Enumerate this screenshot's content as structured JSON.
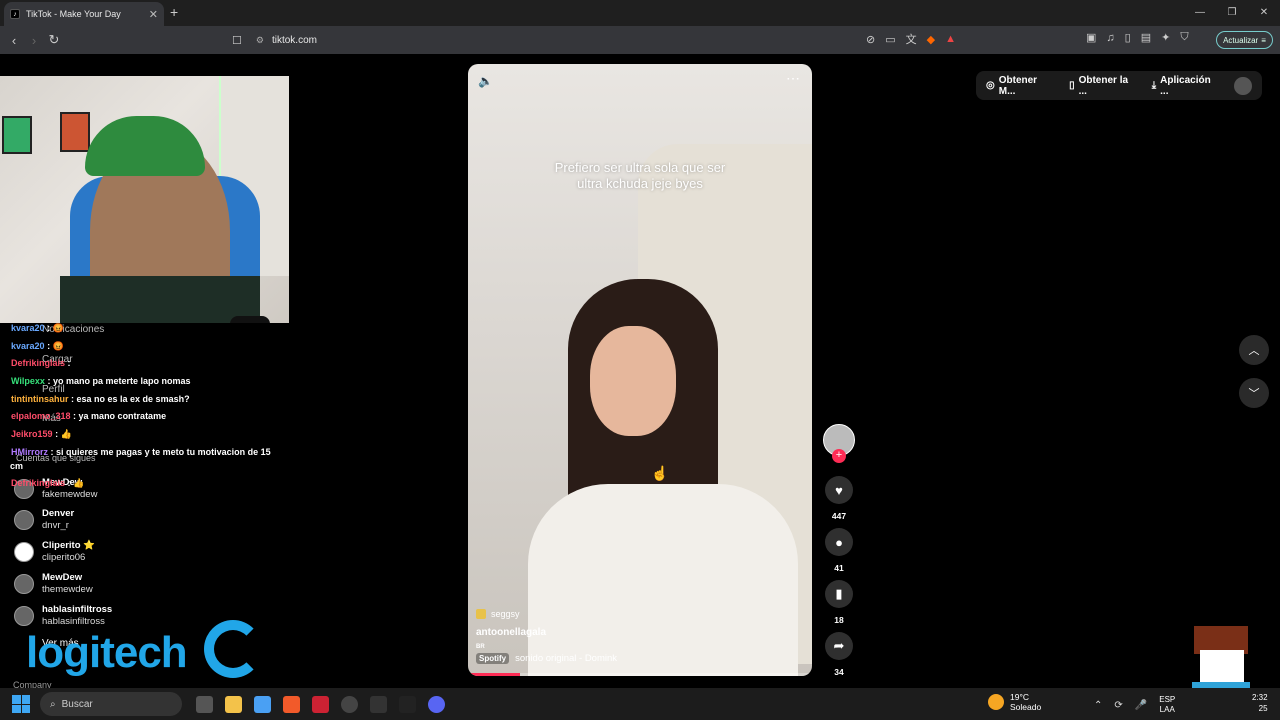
{
  "browser": {
    "tab_title": "TikTok - Make Your Day",
    "new_tab": "+",
    "url": "tiktok.com",
    "update_label": "Actualizar",
    "window_controls": [
      "—",
      "❐",
      "✕"
    ]
  },
  "overlay": {
    "chat": [
      {
        "user": "kvara20",
        "text": ": 😡",
        "color": "blue"
      },
      {
        "user": "kvara20",
        "text": ": 😡",
        "color": "blue"
      },
      {
        "user": "Defrikinglais",
        "text": ":",
        "color": "red"
      },
      {
        "user": "Wilpexx",
        "text": ": yo mano pa meterte lapo nomas",
        "color": "green"
      },
      {
        "user": "tintintinsahur",
        "text": ": esa no es la ex de smash?",
        "color": "orange"
      },
      {
        "user": "elpalomo_318",
        "text": ": ya mano contratame",
        "color": "red"
      },
      {
        "user": "Jeikro159",
        "text": ": 👍",
        "color": "red"
      },
      {
        "user": "HMirrorz",
        "text": ": si quieres me pagas y te meto tu motivacion de 15",
        "color": "purple"
      },
      {
        "user": "cm",
        "text": "",
        "color": "white"
      },
      {
        "user": "Defrikinglais",
        "text": ": 👍",
        "color": "red"
      }
    ],
    "logo_text": "logitech"
  },
  "sidebar": {
    "notifications": "Notificaciones",
    "upload": "Cargar",
    "profile": "Perfil",
    "more": "Más",
    "following_title": "Cuentas que sigues",
    "following": [
      {
        "name": "MewDew",
        "handle": "fakemewdew"
      },
      {
        "name": "Denver",
        "handle": "dnvr_r"
      },
      {
        "name": "Cliperito ⭐",
        "handle": "cliperito06"
      },
      {
        "name": "MewDew",
        "handle": "themewdew"
      },
      {
        "name": "hablasinfiltross",
        "handle": "hablasinfiltross"
      }
    ],
    "see_more": "Ver más",
    "company": "Company"
  },
  "video": {
    "caption_line1": "Prefiero ser ultra sola que ser",
    "caption_line2": "ultra kchuda jeje byes",
    "tag": "seggsy",
    "author": "antoonellagala",
    "region": "BR",
    "spotify": "Spotify",
    "sound": "sonido original - Domink",
    "progress": 0.15,
    "likes": "447",
    "comments": "41",
    "saves": "18",
    "shares": "34"
  },
  "topbar": {
    "get_coins": "Obtener M...",
    "get_app": "Obtener la ...",
    "desktop_app": "Aplicación ..."
  },
  "taskbar": {
    "search": "Buscar",
    "temp": "19°C",
    "weather": "Soleado",
    "lang1": "ESP",
    "lang2": "LAA",
    "time": "2:32",
    "date": "25"
  },
  "colors": {
    "accent": "#fe2c55",
    "logitech": "#21a6e8"
  }
}
